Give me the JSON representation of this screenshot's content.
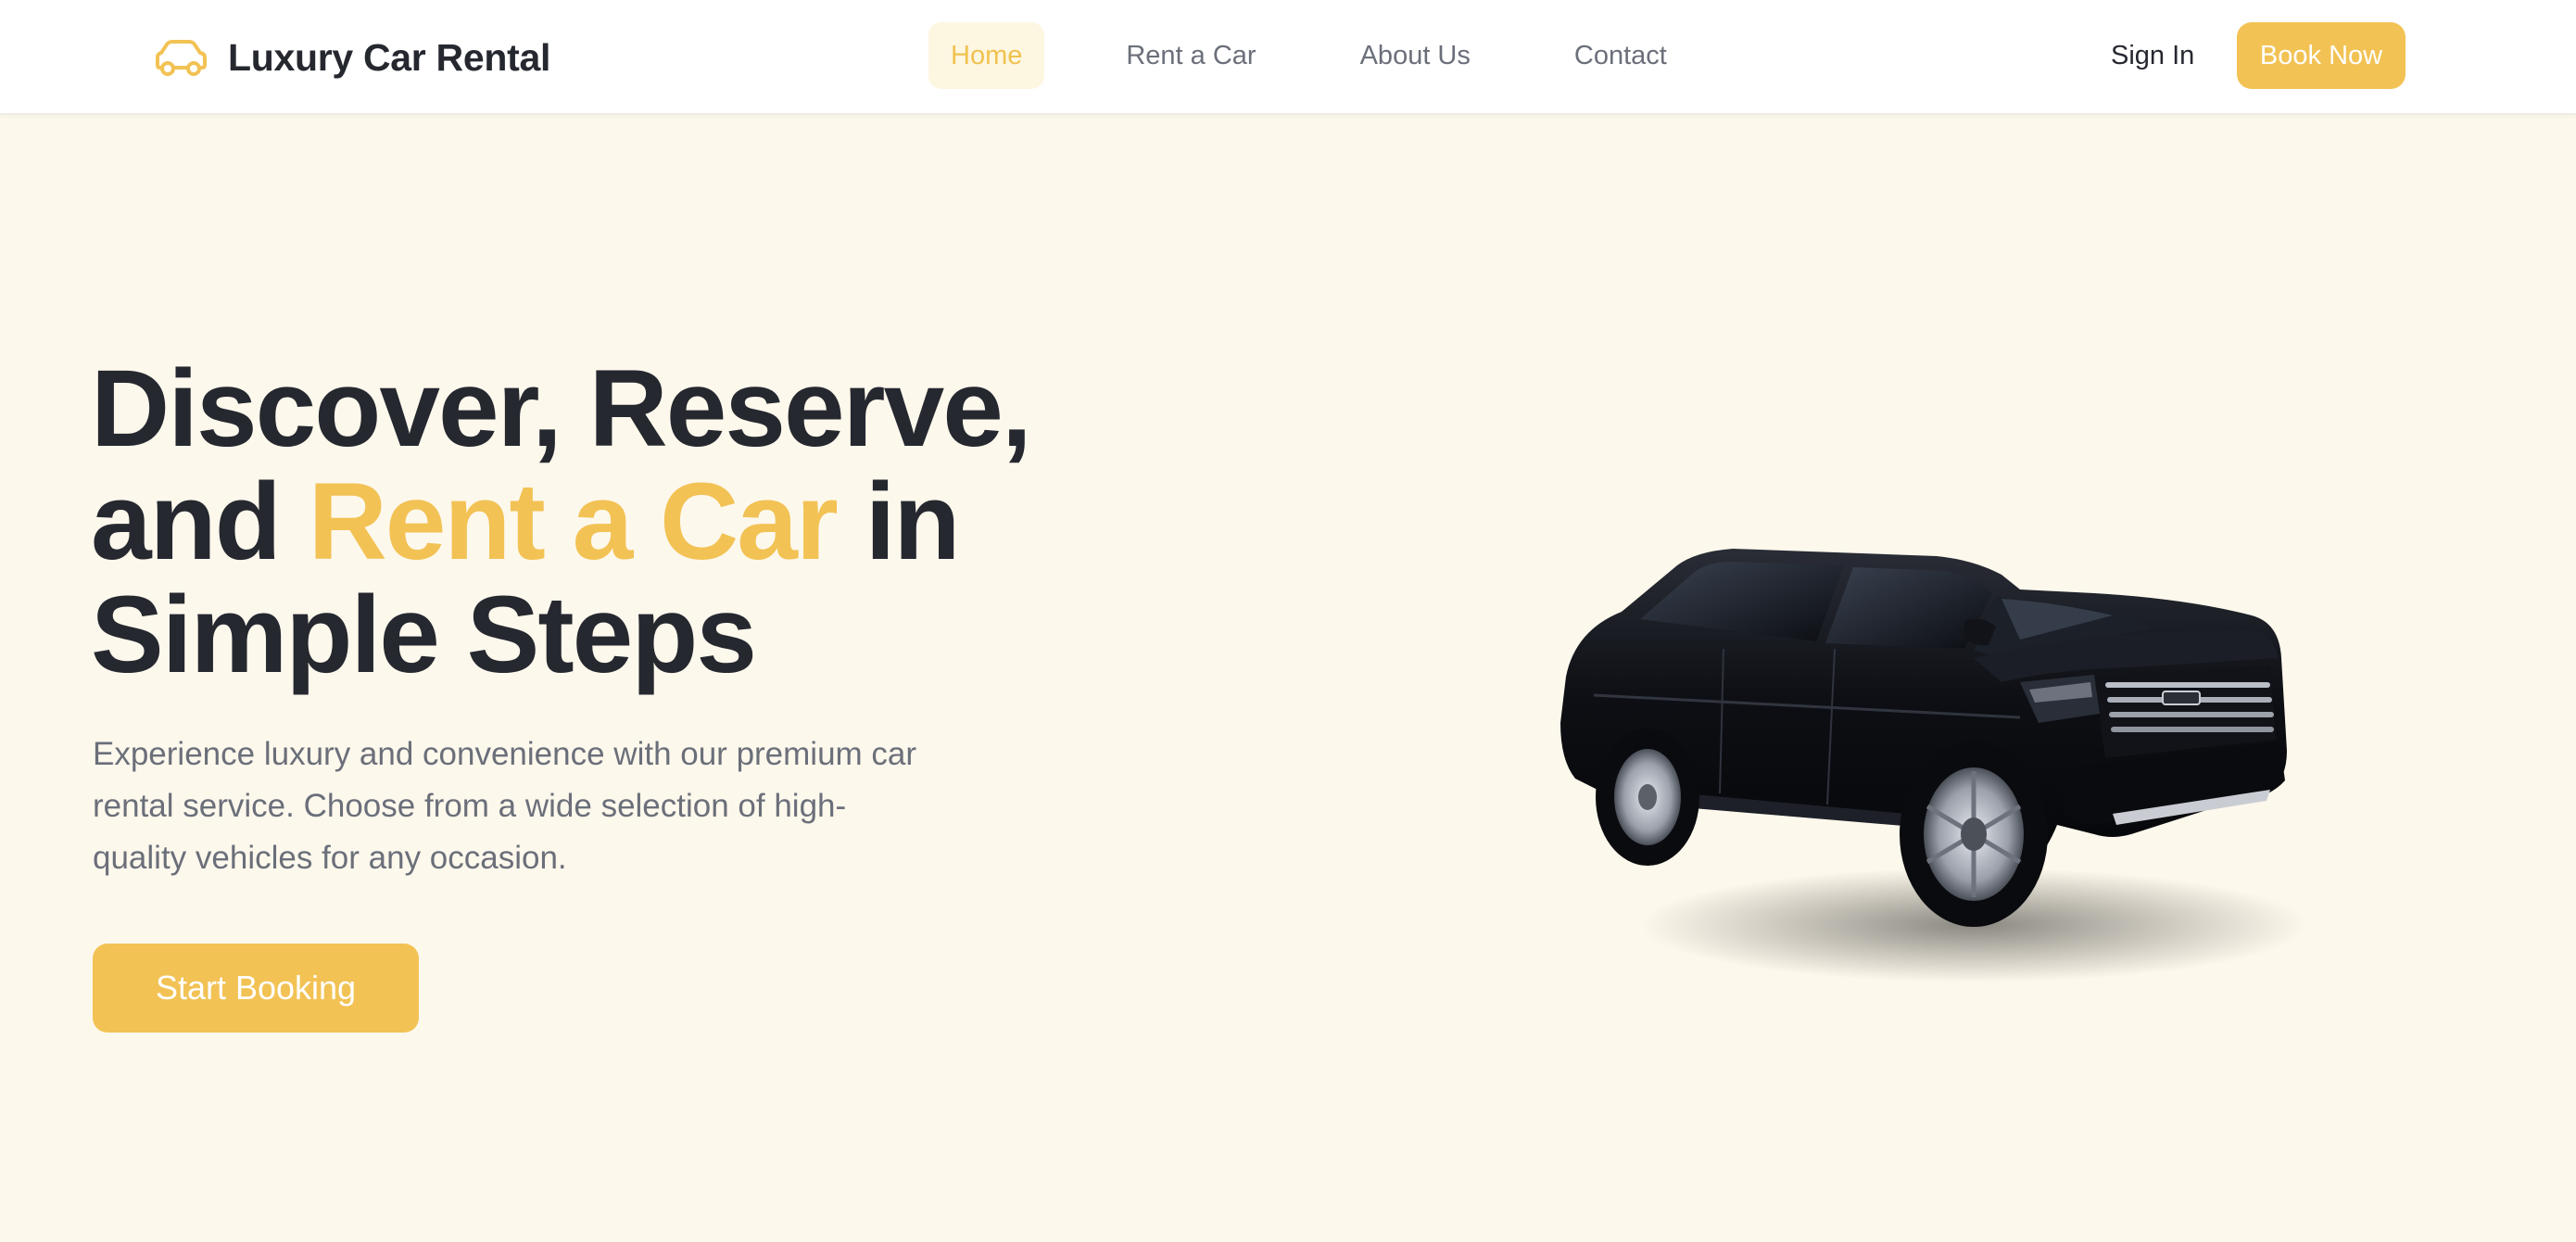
{
  "brand": {
    "name": "Luxury Car Rental",
    "icon": "car-icon"
  },
  "nav": {
    "items": [
      {
        "label": "Home",
        "active": true
      },
      {
        "label": "Rent a Car",
        "active": false
      },
      {
        "label": "About Us",
        "active": false
      },
      {
        "label": "Contact",
        "active": false
      }
    ],
    "sign_in": "Sign In",
    "book_now": "Book Now"
  },
  "hero": {
    "title_part1": "Discover, Reserve,",
    "title_part2": "and",
    "title_accent": "Rent a Car",
    "title_part3": "in",
    "title_part4": "Simple Steps",
    "description": "Experience luxury and convenience with our premium car rental service. Choose from a wide selection of high-quality vehicles for any occasion.",
    "cta": "Start Booking"
  },
  "colors": {
    "accent": "#f2c254",
    "text_dark": "#262830",
    "text_muted": "#6b6f7a",
    "hero_background": "#fdf8ec"
  }
}
